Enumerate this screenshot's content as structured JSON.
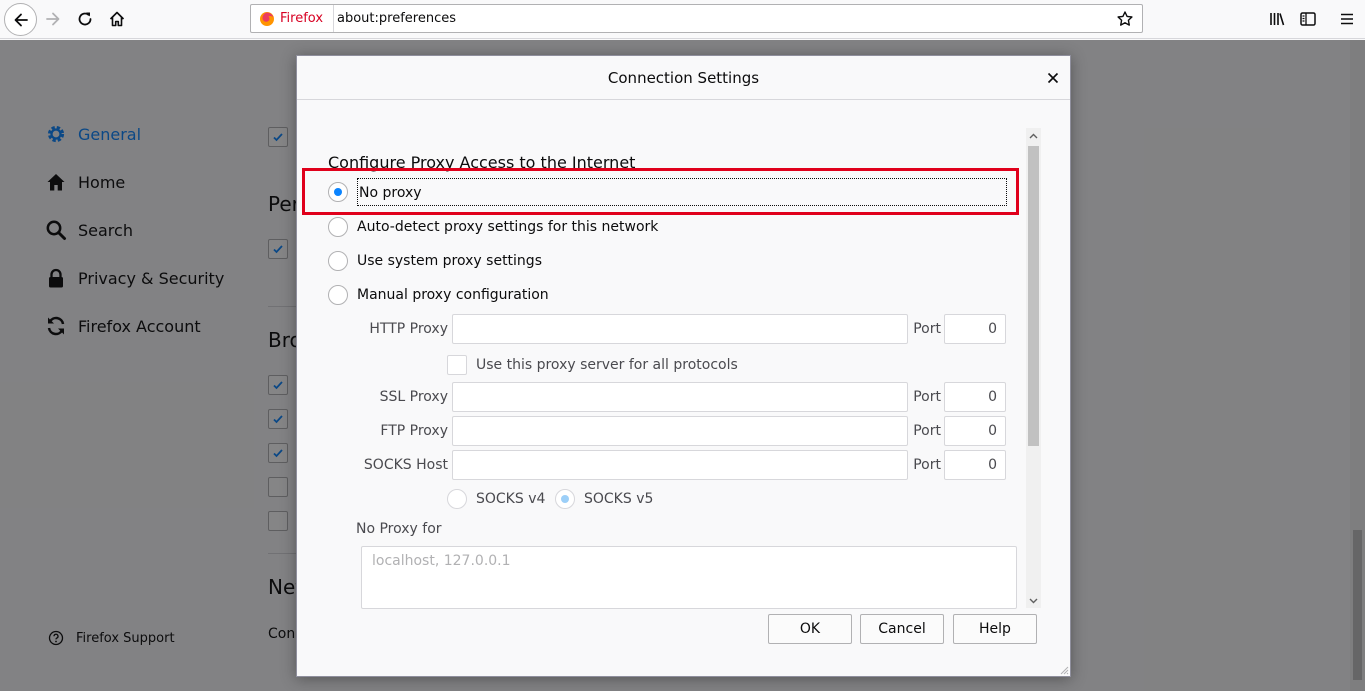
{
  "browser": {
    "identity_label": "Firefox",
    "url": "about:preferences"
  },
  "sidebar": {
    "items": [
      {
        "label": "General",
        "icon": "gear-icon",
        "selected": true
      },
      {
        "label": "Home",
        "icon": "home-icon"
      },
      {
        "label": "Search",
        "icon": "search-icon"
      },
      {
        "label": "Privacy & Security",
        "icon": "lock-icon"
      },
      {
        "label": "Firefox Account",
        "icon": "sync-icon"
      }
    ],
    "support_label": "Firefox Support"
  },
  "background_page": {
    "heading_1": "Per",
    "heading_2": "Bro",
    "heading_3": "Net",
    "text_1": "Con"
  },
  "dialog": {
    "title": "Connection Settings",
    "section_title": "Configure Proxy Access to the Internet",
    "proxy_options": [
      {
        "label": "No proxy",
        "selected": true
      },
      {
        "label": "Auto-detect proxy settings for this network",
        "selected": false
      },
      {
        "label": "Use system proxy settings",
        "selected": false
      },
      {
        "label": "Manual proxy configuration",
        "selected": false
      }
    ],
    "http_proxy_label": "HTTP Proxy",
    "ssl_proxy_label": "SSL Proxy",
    "ftp_proxy_label": "FTP Proxy",
    "socks_host_label": "SOCKS Host",
    "port_label": "Port",
    "http_port": "0",
    "ssl_port": "0",
    "ftp_port": "0",
    "socks_port": "0",
    "share_proxy_label": "Use this proxy server for all protocols",
    "socks_v4_label": "SOCKS v4",
    "socks_v5_label": "SOCKS v5",
    "no_proxy_for_label": "No Proxy for",
    "no_proxy_placeholder": "localhost, 127.0.0.1",
    "ok_label": "OK",
    "cancel_label": "Cancel",
    "help_label": "Help"
  },
  "colors": {
    "accent": "#0a84ff",
    "highlight": "#e0001b"
  }
}
